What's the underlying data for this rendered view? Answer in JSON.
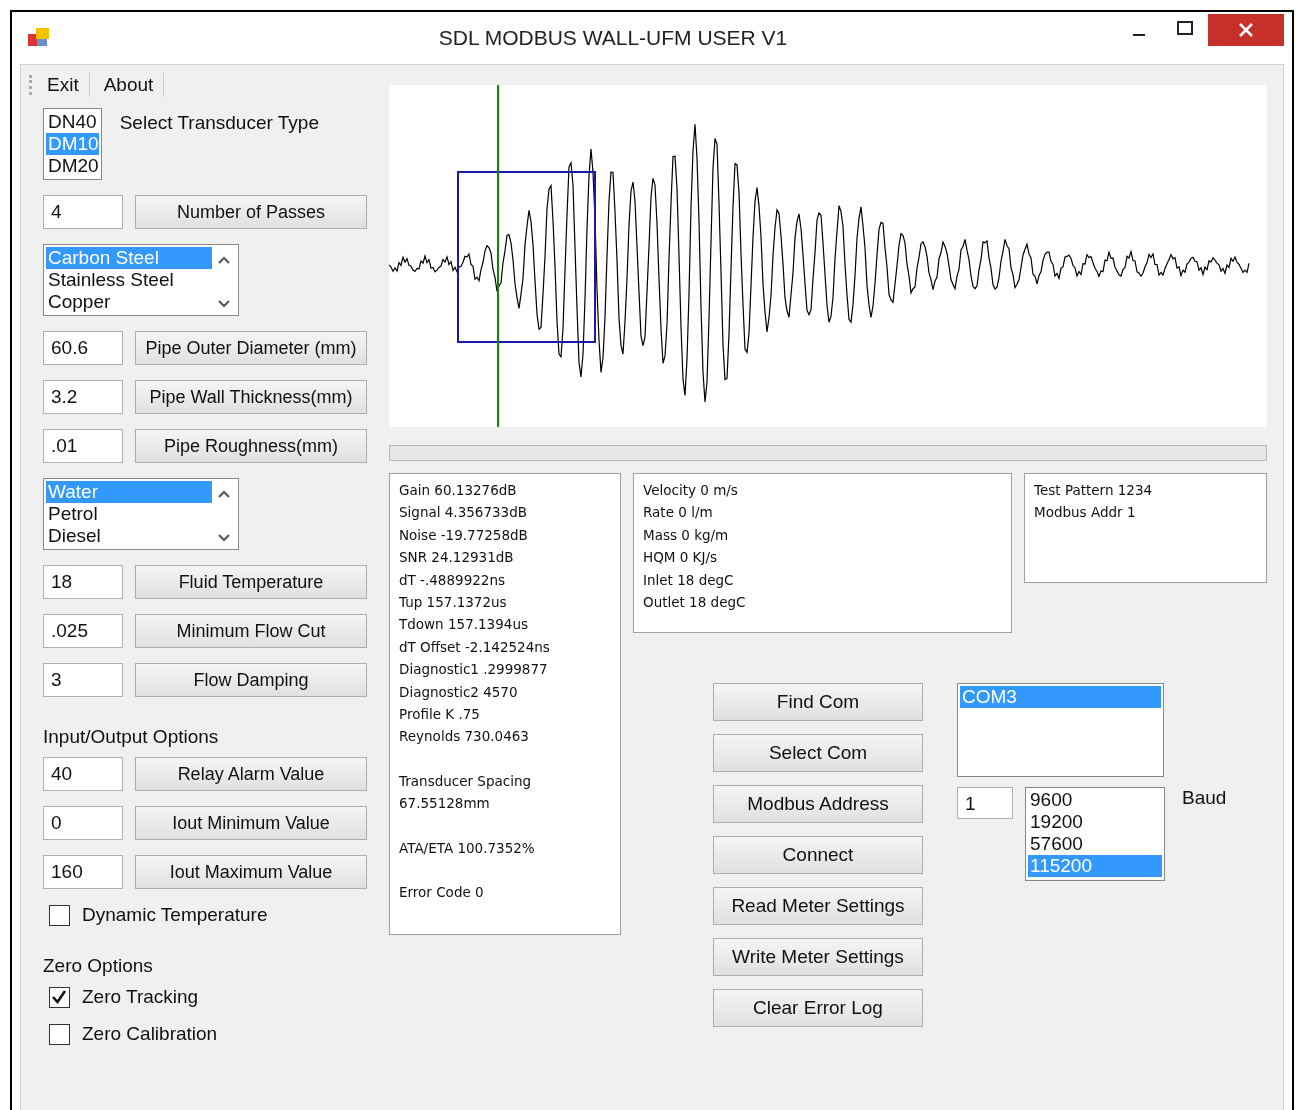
{
  "window": {
    "title": "SDL MODBUS WALL-UFM USER V1"
  },
  "menu": [
    "Exit",
    "About"
  ],
  "left": [
    {
      "kind": "listbox",
      "label": "Select Transducer Type",
      "scroll": false,
      "items": [
        {
          "text": "DN40",
          "selected": false
        },
        {
          "text": "DM10",
          "selected": true
        },
        {
          "text": "DM20",
          "selected": false
        }
      ]
    },
    {
      "kind": "param",
      "value": "4",
      "button": "Number of Passes"
    },
    {
      "kind": "listbox",
      "scroll": true,
      "items": [
        {
          "text": "Carbon Steel",
          "selected": true
        },
        {
          "text": "Stainless Steel",
          "selected": false
        },
        {
          "text": "Copper",
          "selected": false
        }
      ]
    },
    {
      "kind": "param",
      "value": "60.6",
      "button": "Pipe Outer Diameter (mm)"
    },
    {
      "kind": "param",
      "value": "3.2",
      "button": "Pipe Wall Thickness(mm)"
    },
    {
      "kind": "param",
      "value": ".01",
      "button": "Pipe Roughness(mm)"
    },
    {
      "kind": "listbox",
      "scroll": true,
      "items": [
        {
          "text": "Water",
          "selected": true
        },
        {
          "text": "Petrol",
          "selected": false
        },
        {
          "text": "Diesel",
          "selected": false
        }
      ]
    },
    {
      "kind": "param",
      "value": "18",
      "button": "Fluid Temperature"
    },
    {
      "kind": "param",
      "value": ".025",
      "button": "Minimum Flow Cut"
    },
    {
      "kind": "param",
      "value": "3",
      "button": "Flow Damping"
    },
    {
      "kind": "heading",
      "text": "Input/Output Options"
    },
    {
      "kind": "param",
      "value": "40",
      "button": "Relay Alarm Value"
    },
    {
      "kind": "param",
      "value": "0",
      "button": "Iout Minimum Value"
    },
    {
      "kind": "param",
      "value": "160",
      "button": "Iout Maximum Value"
    },
    {
      "kind": "checkbox",
      "label": "Dynamic Temperature",
      "checked": false
    },
    {
      "kind": "heading",
      "text": "Zero Options"
    },
    {
      "kind": "checkbox",
      "label": "Zero Tracking",
      "checked": true
    },
    {
      "kind": "checkbox",
      "label": "Zero Calibration",
      "checked": false
    }
  ],
  "progress": {
    "level": 0
  },
  "readouts": [
    {
      "groups": [
        [
          "Gain 60.13276dB",
          "Signal 4.356733dB",
          "Noise -19.77258dB",
          "SNR 24.12931dB",
          "dT -.4889922ns",
          "Tup 157.1372us",
          "Tdown 157.1394us",
          "dT Offset -2.142524ns",
          "Diagnostic1 .2999877",
          "Diagnostic2 4570",
          "Profile K .75",
          "Reynolds 730.0463"
        ],
        [
          "Transducer Spacing",
          "67.55128mm"
        ],
        [
          "ATA/ETA 100.7352%"
        ],
        [
          "Error Code 0"
        ]
      ]
    },
    {
      "groups": [
        [
          "Velocity 0 m/s",
          "Rate 0 l/m",
          "Mass 0 kg/m",
          "HQM 0 KJ/s",
          "Inlet 18 degC",
          "Outlet 18 degC"
        ]
      ]
    },
    {
      "groups": [
        [
          "Test Pattern 1234",
          "Modbus Addr 1"
        ]
      ]
    }
  ],
  "buttons": [
    "Find Com",
    "Select Com",
    "Modbus Address",
    "Connect",
    "Read Meter Settings",
    "Write Meter Settings",
    "Clear Error Log"
  ],
  "ports": [
    {
      "text": "COM3",
      "selected": true
    }
  ],
  "modbus_address": "1",
  "baud": {
    "label": "Baud",
    "items": [
      {
        "text": "9600",
        "selected": false
      },
      {
        "text": "19200",
        "selected": false
      },
      {
        "text": "57600",
        "selected": false
      },
      {
        "text": "115200",
        "selected": true
      }
    ]
  }
}
